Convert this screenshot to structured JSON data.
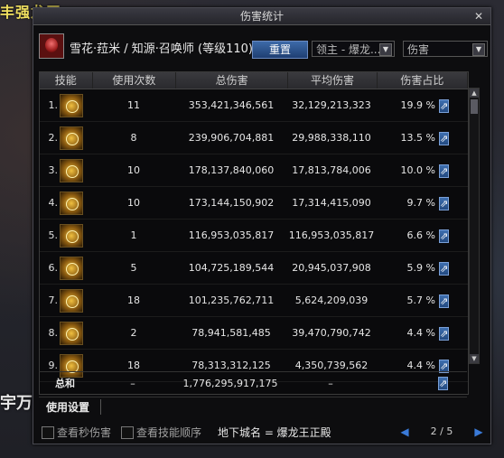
{
  "window": {
    "title": "伤害统计"
  },
  "background": {
    "top_text": "丰强龙平",
    "left_text": "宇万头"
  },
  "header": {
    "char_name": "雪花·菈米 / 知源·召唤师 (等级110)",
    "reset_label": "重置",
    "target_select": "领主 - 爆龙...",
    "mode_select": "伤害"
  },
  "table": {
    "columns": [
      "技能",
      "使用次数",
      "总伤害",
      "平均伤害",
      "伤害占比"
    ],
    "rows": [
      {
        "idx": "1.",
        "uses": "11",
        "total": "353,421,346,561",
        "avg": "32,129,213,323",
        "pct": "19.9 %"
      },
      {
        "idx": "2.",
        "uses": "8",
        "total": "239,906,704,881",
        "avg": "29,988,338,110",
        "pct": "13.5 %"
      },
      {
        "idx": "3.",
        "uses": "10",
        "total": "178,137,840,060",
        "avg": "17,813,784,006",
        "pct": "10.0 %"
      },
      {
        "idx": "4.",
        "uses": "10",
        "total": "173,144,150,902",
        "avg": "17,314,415,090",
        "pct": "9.7 %"
      },
      {
        "idx": "5.",
        "uses": "1",
        "total": "116,953,035,817",
        "avg": "116,953,035,817",
        "pct": "6.6 %"
      },
      {
        "idx": "6.",
        "uses": "5",
        "total": "104,725,189,544",
        "avg": "20,945,037,908",
        "pct": "5.9 %"
      },
      {
        "idx": "7.",
        "uses": "18",
        "total": "101,235,762,711",
        "avg": "5,624,209,039",
        "pct": "5.7 %"
      },
      {
        "idx": "8.",
        "uses": "2",
        "total": "78,941,581,485",
        "avg": "39,470,790,742",
        "pct": "4.4 %"
      },
      {
        "idx": "9.",
        "uses": "18",
        "total": "78,313,312,125",
        "avg": "4,350,739,562",
        "pct": "4.4 %"
      }
    ],
    "total": {
      "label": "总和",
      "uses": "–",
      "total": "1,776,295,917,175",
      "avg": "–"
    }
  },
  "usetab": {
    "label": "使用设置"
  },
  "footer": {
    "check1_label": "查看秒伤害",
    "check2_label": "查看技能顺序",
    "dungeon": "地下城名 = 爆龙王正殿",
    "page": "2 / 5"
  }
}
